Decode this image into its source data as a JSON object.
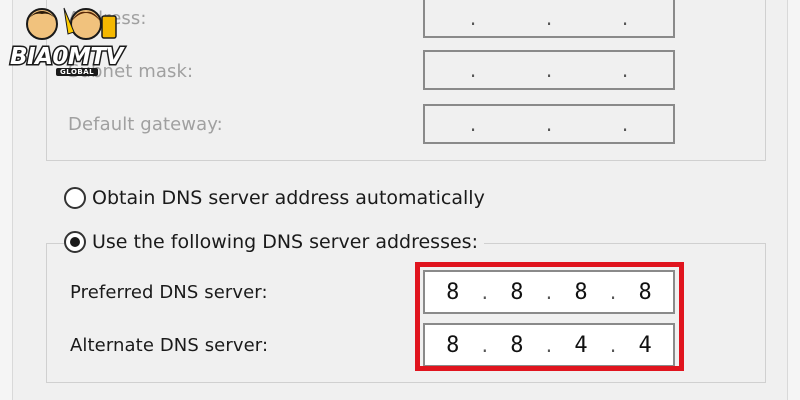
{
  "logo": {
    "text": "BIA0MTV",
    "sub": "GLOBAL"
  },
  "ip_section": {
    "address_label": "Address:",
    "subnet_label": "Subnet mask:",
    "gateway_label": "Default gateway:"
  },
  "dns": {
    "auto_label": "Obtain DNS server address automatically",
    "manual_label": "Use the following DNS server addresses:",
    "preferred_label": "Preferred DNS server:",
    "preferred_value": [
      "8",
      "8",
      "8",
      "8"
    ],
    "alternate_label": "Alternate DNS server:",
    "alternate_value": [
      "8",
      "8",
      "4",
      "4"
    ],
    "selected": "manual"
  },
  "colors": {
    "highlight": "#e0141e",
    "background": "#f0f0f0"
  },
  "icons": {
    "logo": "biaom-tv-logo-icon",
    "radio_on": "radio-checked-icon",
    "radio_off": "radio-unchecked-icon"
  }
}
